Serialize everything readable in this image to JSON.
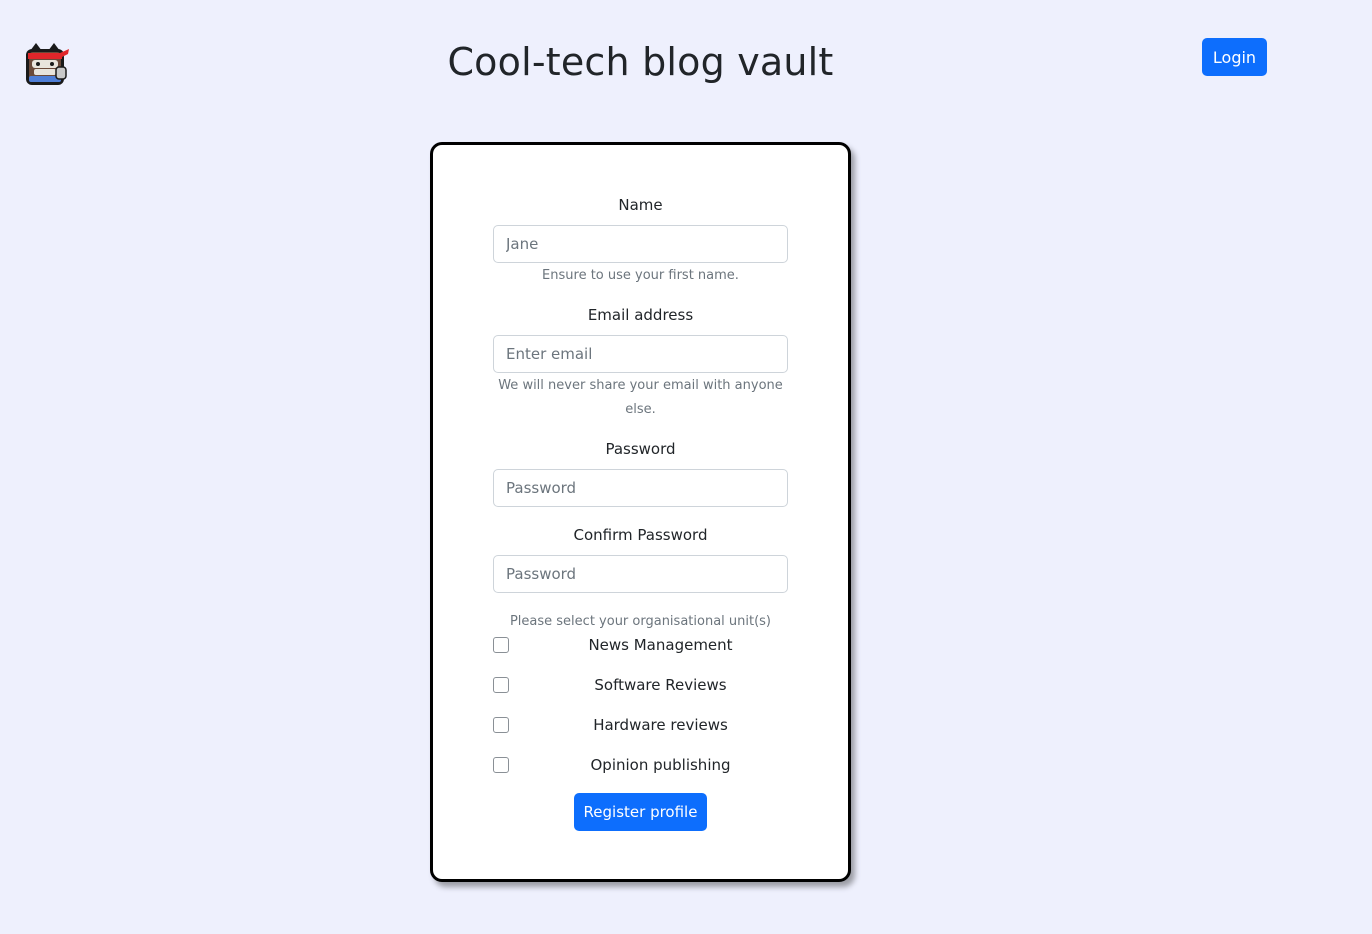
{
  "header": {
    "title": "Cool-tech blog vault",
    "login_label": "Login",
    "logo_icon": "ninja-cat-logo-icon"
  },
  "form": {
    "name": {
      "label": "Name",
      "placeholder": "Jane",
      "help": "Ensure to use your first name."
    },
    "email": {
      "label": "Email address",
      "placeholder": "Enter email",
      "help": "We will never share your email with anyone else."
    },
    "password": {
      "label": "Password",
      "placeholder": "Password"
    },
    "confirm_password": {
      "label": "Confirm Password",
      "placeholder": "Password"
    },
    "units_note": "Please select your organisational unit(s)",
    "units": [
      {
        "label": "News Management",
        "checked": false
      },
      {
        "label": "Software Reviews",
        "checked": false
      },
      {
        "label": "Hardware reviews",
        "checked": false
      },
      {
        "label": "Opinion publishing",
        "checked": false
      }
    ],
    "submit_label": "Register profile"
  },
  "colors": {
    "background": "#eef0fd",
    "accent": "#0d6efd",
    "card_border": "#000000"
  }
}
